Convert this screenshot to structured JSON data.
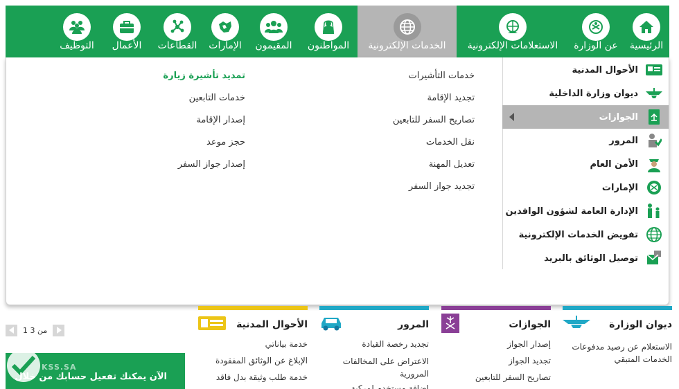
{
  "nav": {
    "items": [
      {
        "label": "الرئيسية",
        "icon": "home-icon"
      },
      {
        "label": "عن الوزارة",
        "icon": "emblem-icon"
      },
      {
        "label": "الاستعلامات الإلكترونية",
        "icon": "globe-hand-icon"
      },
      {
        "label": "الخدمات الإلكترونية",
        "icon": "globe-icon",
        "active": true
      },
      {
        "label": "المواطنون",
        "icon": "citizen-icon"
      },
      {
        "label": "المقيمون",
        "icon": "people-icon"
      },
      {
        "label": "الإمارات",
        "icon": "map-icon"
      },
      {
        "label": "القطاعات",
        "icon": "network-icon"
      },
      {
        "label": "الأعمال",
        "icon": "briefcase-icon"
      },
      {
        "label": "التوظيف",
        "icon": "team-icon"
      }
    ]
  },
  "dropdown": {
    "sidebar": [
      {
        "label": "الأحوال المدنية",
        "icon": "id-card-icon"
      },
      {
        "label": "ديوان وزارة الداخلية",
        "icon": "ministry-icon"
      },
      {
        "label": "الجوازات",
        "icon": "passport-icon",
        "active": true
      },
      {
        "label": "المرور",
        "icon": "traffic-icon"
      },
      {
        "label": "الأمن العام",
        "icon": "officer-icon"
      },
      {
        "label": "الإمارات",
        "icon": "emblem-icon"
      },
      {
        "label": "الإدارة العامة لشؤون الوافدين",
        "icon": "expat-icon"
      },
      {
        "label": "تفويض الخدمات الإلكترونية",
        "icon": "globe-icon"
      },
      {
        "label": "توصيل الوثائق بالبريد",
        "icon": "mail-icon"
      }
    ],
    "column1": [
      "خدمات التأشيرات",
      "تجديد الإقامة",
      "تصاريح السفر للتابعين",
      "نقل الخدمات",
      "تعديل المهنة",
      "تجديد جواز السفر"
    ],
    "column2": [
      "تمديد تأشيرة زيارة",
      "خدمات التابعين",
      "إصدار الإقامة",
      "حجز موعد",
      "إصدار جواز السفر"
    ],
    "column2_highlight_index": 0
  },
  "pager": {
    "text": "1 من 3"
  },
  "promo": {
    "brand": "KSS.SA",
    "title": "الآن يمكنك تفعيل حسابك من خلال"
  },
  "cards": [
    {
      "title": "ديوان الوزارة",
      "color": "#20a8c6",
      "icon": "ministry-icon",
      "links": [
        "الاستعلام عن رصيد مدفوعات",
        "الخدمات المتبقي"
      ]
    },
    {
      "title": "الجوازات",
      "color": "#8a3f96",
      "icon": "palm-swords-icon",
      "links": [
        "إصدار الجواز",
        "تجديد الجواز",
        "تصاريح السفر للتابعين"
      ]
    },
    {
      "title": "المرور",
      "color": "#20a8c6",
      "icon": "car-icon",
      "links": [
        "تجديد رخصة القيادة",
        "الاعتراض على المخالفات",
        "المرورية",
        "إضافة مستخدم لمركبة"
      ]
    },
    {
      "title": "الأحوال المدنية",
      "color": "#ecc517",
      "icon": "id-card-icon",
      "links": [
        "خدمة بياناتي",
        "الإبلاغ عن الوثائق المفقودة",
        "خدمة طلب وثيقة بدل فاقد"
      ]
    }
  ],
  "colors": {
    "brand": "#1aa054",
    "active_grey": "#b5b5b5"
  }
}
